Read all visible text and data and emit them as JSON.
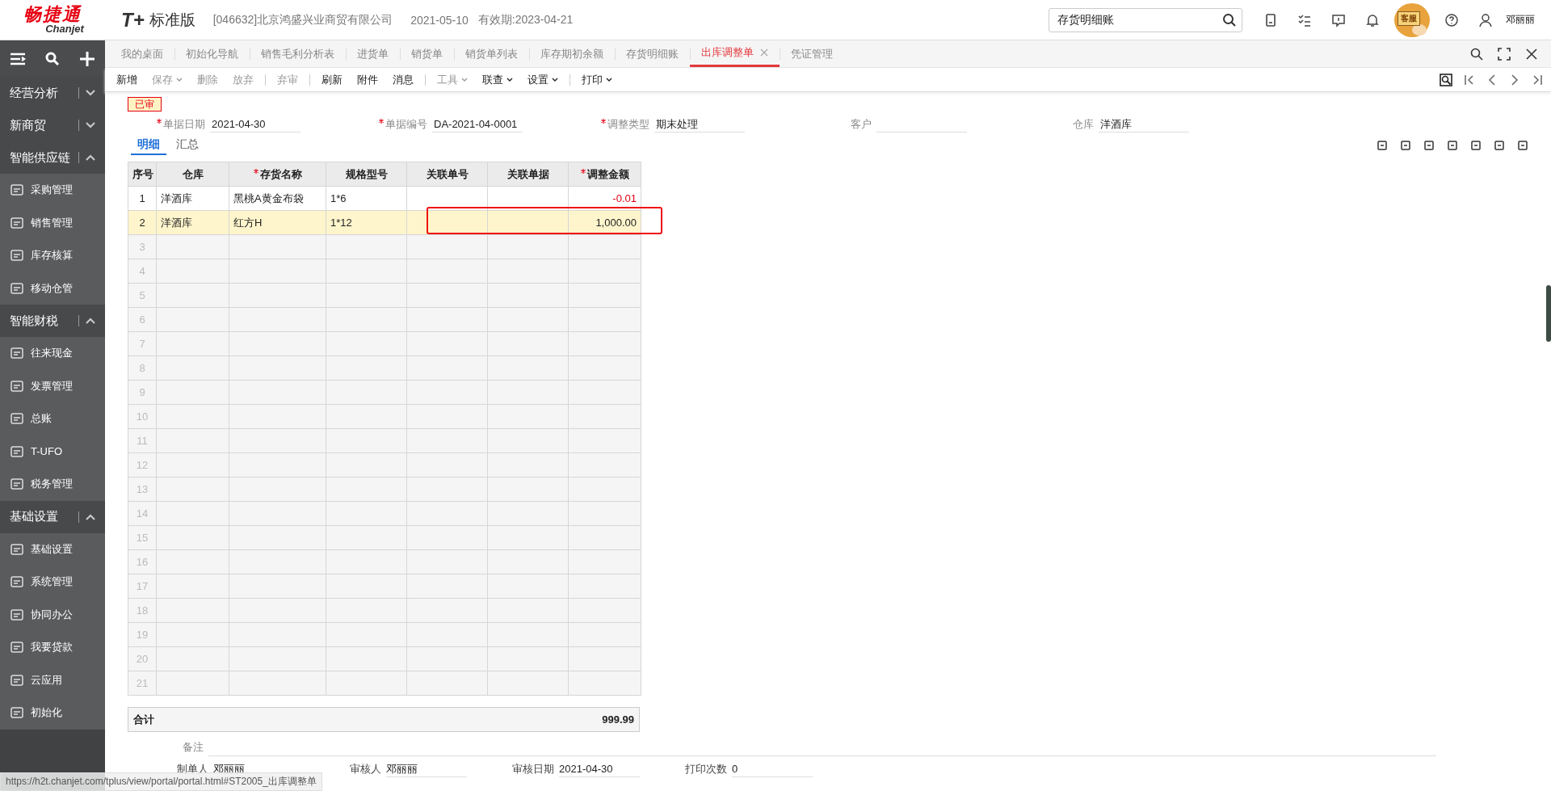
{
  "header": {
    "brand": "畅捷通",
    "brand_sub": "Chanjet",
    "product": "T+",
    "edition": "标准版",
    "company": "[046632]北京鸿盛兴业商贸有限公司",
    "date": "2021-05-10",
    "expiry": "有效期:2023-04-21",
    "search": {
      "value": "存货明细账"
    },
    "mascot_label": "客服",
    "user": "邓丽丽"
  },
  "sidebar": {
    "groups": [
      {
        "label": "经营分析",
        "expanded": false
      },
      {
        "label": "新商贸",
        "expanded": false
      },
      {
        "label": "智能供应链",
        "expanded": true,
        "items": [
          "采购管理",
          "销售管理",
          "库存核算",
          "移动仓管"
        ]
      },
      {
        "label": "智能财税",
        "expanded": true,
        "items": [
          "往来现金",
          "发票管理",
          "总账",
          "T-UFO",
          "税务管理"
        ]
      },
      {
        "label": "基础设置",
        "expanded": true,
        "items": [
          "基础设置",
          "系统管理",
          "协同办公",
          "我要贷款",
          "云应用",
          "初始化"
        ]
      }
    ]
  },
  "tabs": [
    {
      "label": "我的桌面",
      "selected": false
    },
    {
      "label": "初始化导航",
      "selected": false
    },
    {
      "label": "销售毛利分析表",
      "selected": false
    },
    {
      "label": "进货单",
      "selected": false
    },
    {
      "label": "销货单",
      "selected": false
    },
    {
      "label": "销货单列表",
      "selected": false
    },
    {
      "label": "库存期初余额",
      "selected": false
    },
    {
      "label": "存货明细账",
      "selected": false
    },
    {
      "label": "出库调整单",
      "selected": true
    },
    {
      "label": "凭证管理",
      "selected": false
    }
  ],
  "toolbar": [
    [
      {
        "label": "新增",
        "disabled": false,
        "dropdown": false
      },
      {
        "label": "保存",
        "disabled": true,
        "dropdown": true
      },
      {
        "label": "删除",
        "disabled": true,
        "dropdown": false
      },
      {
        "label": "放弃",
        "disabled": true,
        "dropdown": false
      }
    ],
    [
      {
        "label": "弃审",
        "disabled": true,
        "dropdown": false
      }
    ],
    [
      {
        "label": "刷新",
        "disabled": false,
        "dropdown": false
      },
      {
        "label": "附件",
        "disabled": false,
        "dropdown": false
      },
      {
        "label": "消息",
        "disabled": false,
        "dropdown": false
      }
    ],
    [
      {
        "label": "工具",
        "disabled": true,
        "dropdown": true
      },
      {
        "label": "联查",
        "disabled": false,
        "dropdown": true
      },
      {
        "label": "设置",
        "disabled": false,
        "dropdown": true
      }
    ],
    [
      {
        "label": "打印",
        "disabled": false,
        "dropdown": true
      }
    ]
  ],
  "status_stamp": "已审",
  "form_fields": [
    {
      "label": "单据日期",
      "required": true,
      "value": "2021-04-30"
    },
    {
      "label": "单据编号",
      "required": true,
      "value": "DA-2021-04-0001"
    },
    {
      "label": "调整类型",
      "required": true,
      "value": "期末处理"
    },
    {
      "label": "客户",
      "required": false
    },
    {
      "label": "仓库",
      "required": false,
      "value": "洋酒库"
    }
  ],
  "detail_tabs": [
    {
      "label": "明细",
      "selected": true
    },
    {
      "label": "汇总",
      "selected": false
    }
  ],
  "table": {
    "columns": [
      {
        "label": "序号",
        "required": false
      },
      {
        "label": "仓库",
        "required": false
      },
      {
        "label": "存货名称",
        "required": true
      },
      {
        "label": "规格型号",
        "required": false
      },
      {
        "label": "关联单号",
        "required": false
      },
      {
        "label": "关联单据",
        "required": false
      },
      {
        "label": "调整金额",
        "required": true
      }
    ],
    "rows": [
      {
        "no": "1",
        "cells": [
          "洋酒库",
          "黑桃A黄金布袋",
          "1*6",
          "",
          "",
          "-0.01"
        ],
        "selected": false,
        "negative": true,
        "annotated": false
      },
      {
        "no": "2",
        "cells": [
          "洋酒库",
          "红方H",
          "1*12",
          "",
          "",
          "1,000.00"
        ],
        "selected": true,
        "negative": false,
        "annotated": true
      },
      {
        "no": "3"
      },
      {
        "no": "4"
      },
      {
        "no": "5"
      },
      {
        "no": "6"
      },
      {
        "no": "7"
      },
      {
        "no": "8"
      },
      {
        "no": "9"
      },
      {
        "no": "10"
      },
      {
        "no": "11"
      },
      {
        "no": "12"
      },
      {
        "no": "13"
      },
      {
        "no": "14"
      },
      {
        "no": "15"
      },
      {
        "no": "16"
      },
      {
        "no": "17"
      },
      {
        "no": "18"
      },
      {
        "no": "19"
      },
      {
        "no": "20"
      },
      {
        "no": "21"
      }
    ],
    "total_label": "合计",
    "total_value": "999.99"
  },
  "remark": {
    "label": "备注"
  },
  "footer_fields": [
    {
      "label": "制单人",
      "value": "邓丽丽"
    },
    {
      "label": "审核人",
      "value": "邓丽丽"
    },
    {
      "label": "审核日期",
      "value": "2021-04-30"
    },
    {
      "label": "打印次数",
      "value": "0"
    }
  ],
  "status_url": "https://h2t.chanjet.com/tplus/view/portal/portal.html#ST2005_出库调整单"
}
